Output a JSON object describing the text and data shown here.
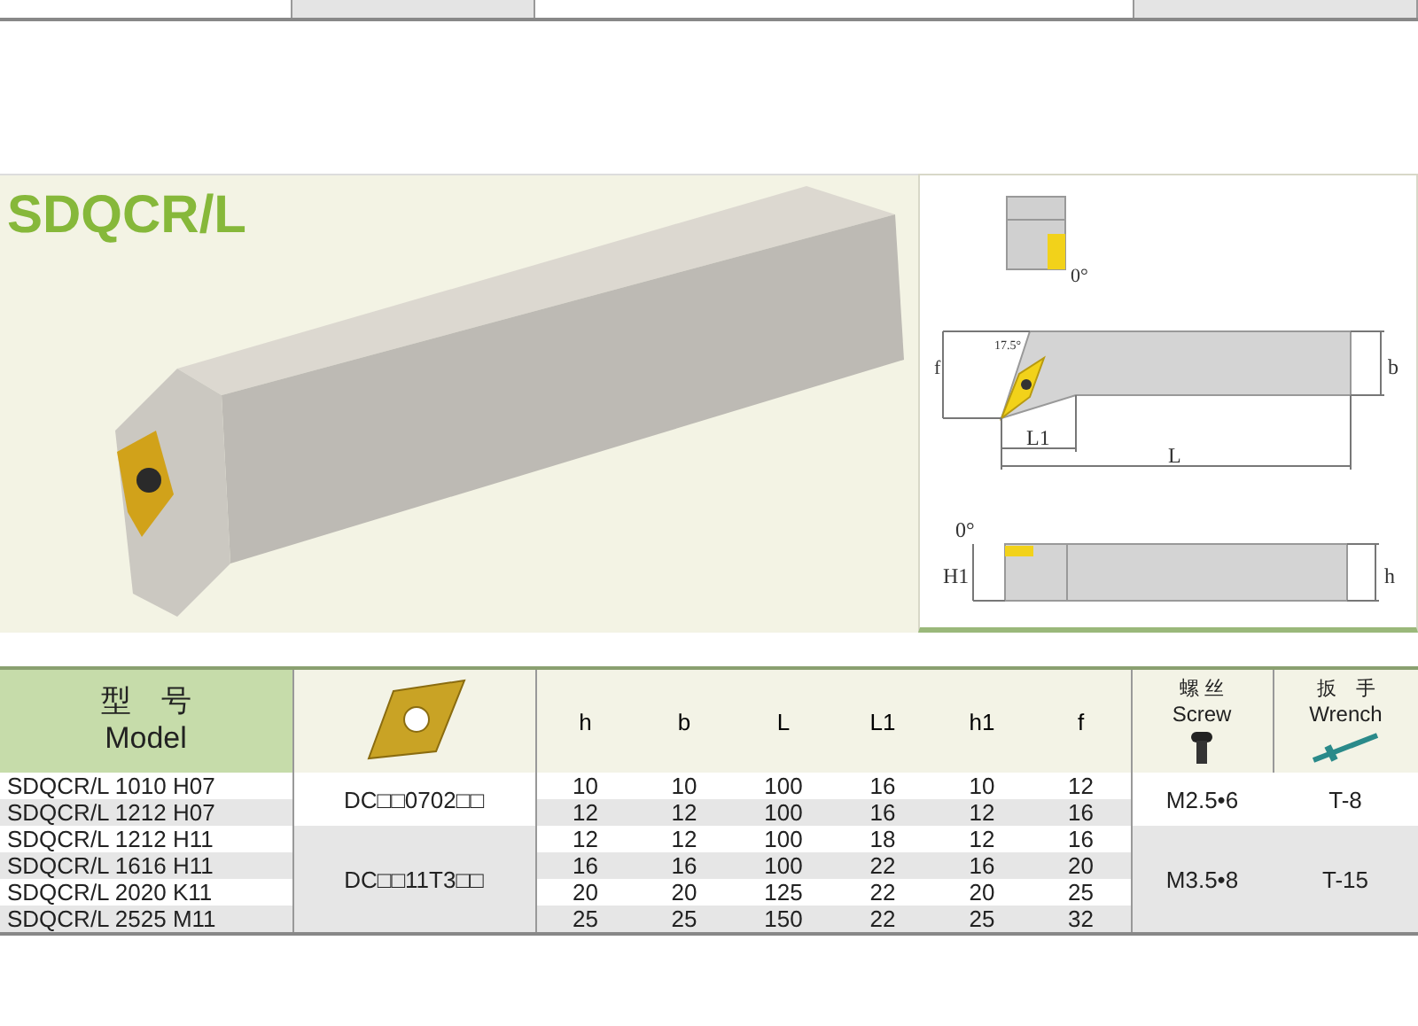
{
  "title": "SDQCR/L",
  "diagram": {
    "angle_top": "0°",
    "angle_lead": "17.5°",
    "f": "f",
    "b": "b",
    "L1": "L1",
    "L": "L",
    "angle_side": "0°",
    "H1": "H1",
    "h": "h"
  },
  "table": {
    "header": {
      "model_zh": "型　号",
      "model_en": "Model",
      "dims": [
        "h",
        "b",
        "L",
        "L1",
        "h1",
        "f"
      ],
      "screw_zh": "螺 丝",
      "screw_en": "Screw",
      "wrench_zh": "扳　手",
      "wrench_en": "Wrench"
    },
    "groups": [
      {
        "insert": "DC□□0702□□",
        "screw": "M2.5•6",
        "wrench": "T-8",
        "rows": [
          {
            "model": "SDQCR/L 1010 H07",
            "values": [
              "10",
              "10",
              "100",
              "16",
              "10",
              "12"
            ]
          },
          {
            "model": "SDQCR/L 1212 H07",
            "values": [
              "12",
              "12",
              "100",
              "16",
              "12",
              "16"
            ]
          }
        ]
      },
      {
        "insert": "DC□□11T3□□",
        "screw": "M3.5•8",
        "wrench": "T-15",
        "rows": [
          {
            "model": "SDQCR/L 1212 H11",
            "values": [
              "12",
              "12",
              "100",
              "18",
              "12",
              "16"
            ]
          },
          {
            "model": "SDQCR/L 1616 H11",
            "values": [
              "16",
              "16",
              "100",
              "22",
              "16",
              "20"
            ]
          },
          {
            "model": "SDQCR/L 2020 K11",
            "values": [
              "20",
              "20",
              "125",
              "22",
              "20",
              "25"
            ]
          },
          {
            "model": "SDQCR/L 2525 M11",
            "values": [
              "25",
              "25",
              "150",
              "22",
              "25",
              "32"
            ]
          }
        ]
      }
    ]
  }
}
